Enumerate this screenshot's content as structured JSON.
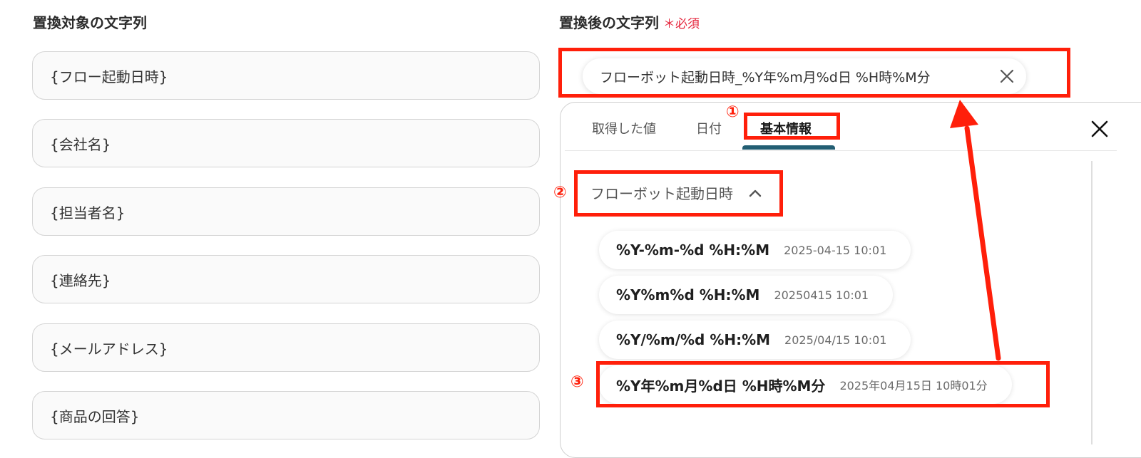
{
  "left": {
    "label": "置換対象の文字列",
    "fields": [
      "{フロー起動日時}",
      "{会社名}",
      "{担当者名}",
      "{連絡先}",
      "{メールアドレス}",
      "{商品の回答}"
    ]
  },
  "right": {
    "label": "置換後の文字列",
    "required_mark": "＊",
    "required_text": "必須",
    "chip_text": "フローボット起動日時_%Y年%m月%d日 %H時%M分"
  },
  "panel": {
    "tabs": [
      "取得した値",
      "日付",
      "基本情報"
    ],
    "active_tab": "基本情報",
    "accordion_label": "フローボット起動日時",
    "options": [
      {
        "format": "%Y-%m-%d %H:%M",
        "example": "2025-04-15 10:01"
      },
      {
        "format": "%Y%m%d %H:%M",
        "example": "20250415 10:01"
      },
      {
        "format": "%Y/%m/%d %H:%M",
        "example": "2025/04/15 10:01"
      },
      {
        "format": "%Y年%m月%d日 %H時%M分",
        "example": "2025年04月15日 10時01分"
      }
    ]
  },
  "annotations": {
    "step1": "①",
    "step2": "②",
    "step3": "③",
    "highlight_color": "#ff1f0a"
  },
  "colors": {
    "accent": "#235e73",
    "required": "#e5243b"
  },
  "icons": {
    "chip_remove": "close-icon",
    "panel_close": "close-icon",
    "accordion": "chevron-up-icon"
  }
}
